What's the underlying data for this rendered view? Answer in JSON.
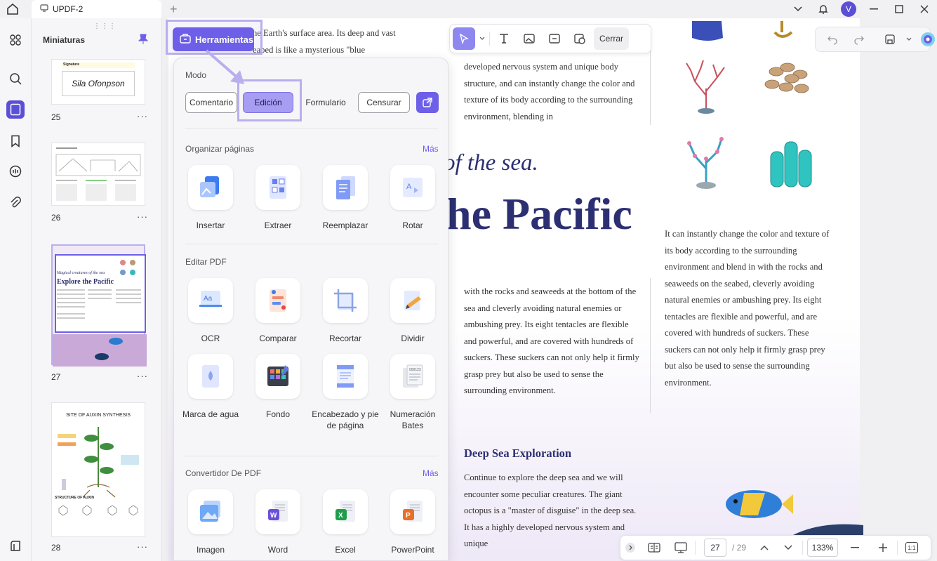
{
  "titlebar": {
    "tab_title": "UPDF-2",
    "avatar_initial": "V"
  },
  "thumbnails": {
    "title": "Miniaturas",
    "more": "···",
    "pages": [
      {
        "number": "25",
        "label_text": "Signature",
        "signature": "Sila Ofonpson"
      },
      {
        "number": "26"
      },
      {
        "number": "27",
        "mini_subtitle": "Magical creatures of the sea",
        "mini_title": "Explore the Pacific"
      },
      {
        "number": "28",
        "mini_title": "SITE OF AUXIN SYNTHESIS",
        "mini_subtitle": "STRUCTURE OF AUXIN"
      }
    ]
  },
  "toolbar": {
    "tools_label": "Herramientas",
    "close_label": "Cerrar"
  },
  "panel": {
    "mode_label": "Modo",
    "modes": [
      "Comentario",
      "Edición",
      "Formulario",
      "Censurar"
    ],
    "active_mode": "Edición",
    "sections": [
      {
        "title": "Organizar páginas",
        "more": "Más",
        "tools": [
          "Insertar",
          "Extraer",
          "Reemplazar",
          "Rotar"
        ]
      },
      {
        "title": "Editar PDF",
        "more": "",
        "tools": [
          "OCR",
          "Comparar",
          "Recortar",
          "Dividir",
          "Marca de agua",
          "Fondo",
          "Encabezado y pie de página",
          "Numeración Bates"
        ]
      },
      {
        "title": "Convertidor De PDF",
        "more": "Más",
        "tools": [
          "Imagen",
          "Word",
          "Excel",
          "PowerPoint"
        ]
      }
    ],
    "tool_sub": {
      "word": "W",
      "excel": "X",
      "powerpoint": "P",
      "ocr": "Aa",
      "rotar": "A",
      "bates": "000123"
    }
  },
  "document": {
    "line_top_1": "he Earth's surface area. Its deep and vast",
    "line_top_2": "eabed is like a mysterious \"blue",
    "col1_top": "developed nervous system and unique body structure, and can instantly change the color and texture of its body according to the surrounding environment, blending in",
    "italic_heading": "of the sea.",
    "big_heading": "he Pacific",
    "col1_mid": "with the rocks and seaweeds at the bottom of the sea and cleverly avoiding natural enemies or ambushing prey. Its eight tentacles are flexible and powerful, and are covered with hundreds of suckers. These suckers can not only help it firmly grasp prey but also be used to sense the surrounding environment.",
    "col2": "It can instantly change the color and texture of its body according to the surrounding environment and blend in with the rocks and seaweeds on the seabed, cleverly avoiding natural enemies or ambushing prey. Its eight tentacles are flexible and powerful, and are covered with hundreds of suckers. These suckers can not only help it firmly grasp prey but also be used to sense the surrounding environment.",
    "section_heading": "Deep Sea Exploration",
    "col1_bottom": "Continue to explore the deep sea and we will encounter some peculiar creatures. The giant octopus is a \"master of disguise\" in the deep sea. It has a highly developed nervous system and unique"
  },
  "bottom": {
    "current_page": "27",
    "total_pages": "/ 29",
    "zoom": "133%",
    "fit": "1:1"
  },
  "colors": {
    "accent": "#6d5fe8",
    "active_mode": "#a79df2",
    "highlight": "#b9afee",
    "heading": "#2c2f72"
  }
}
